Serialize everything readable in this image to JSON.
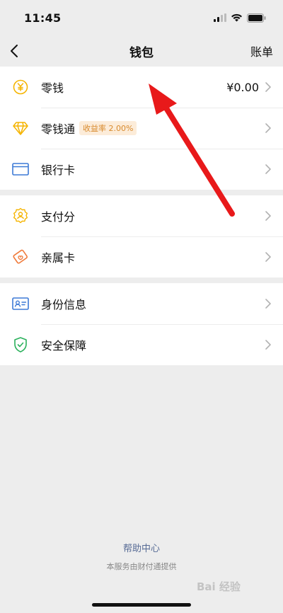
{
  "status": {
    "time": "11:45"
  },
  "nav": {
    "back_icon": "chevron-left-icon",
    "title": "钱包",
    "action_label": "账单"
  },
  "groups": [
    {
      "items": [
        {
          "label": "零钱",
          "value": "¥0.00",
          "icon": "yuan-coin-icon",
          "color": "#f5b400"
        },
        {
          "label": "零钱通",
          "badge": "收益率 2.00%",
          "icon": "diamond-icon",
          "color": "#f5b400"
        },
        {
          "label": "银行卡",
          "icon": "card-icon",
          "color": "#3d7ad6"
        }
      ]
    },
    {
      "items": [
        {
          "label": "支付分",
          "icon": "score-badge-icon",
          "color": "#f5b400"
        },
        {
          "label": "亲属卡",
          "icon": "family-card-icon",
          "color": "#f07a3a"
        }
      ]
    },
    {
      "items": [
        {
          "label": "身份信息",
          "icon": "id-card-icon",
          "color": "#3d7ad6"
        },
        {
          "label": "安全保障",
          "icon": "shield-check-icon",
          "color": "#2bb15c"
        }
      ]
    }
  ],
  "footer": {
    "help_link": "帮助中心",
    "note": "本服务由财付通提供"
  },
  "watermark": "Bai 经验",
  "annotation_color": "#e8191a"
}
